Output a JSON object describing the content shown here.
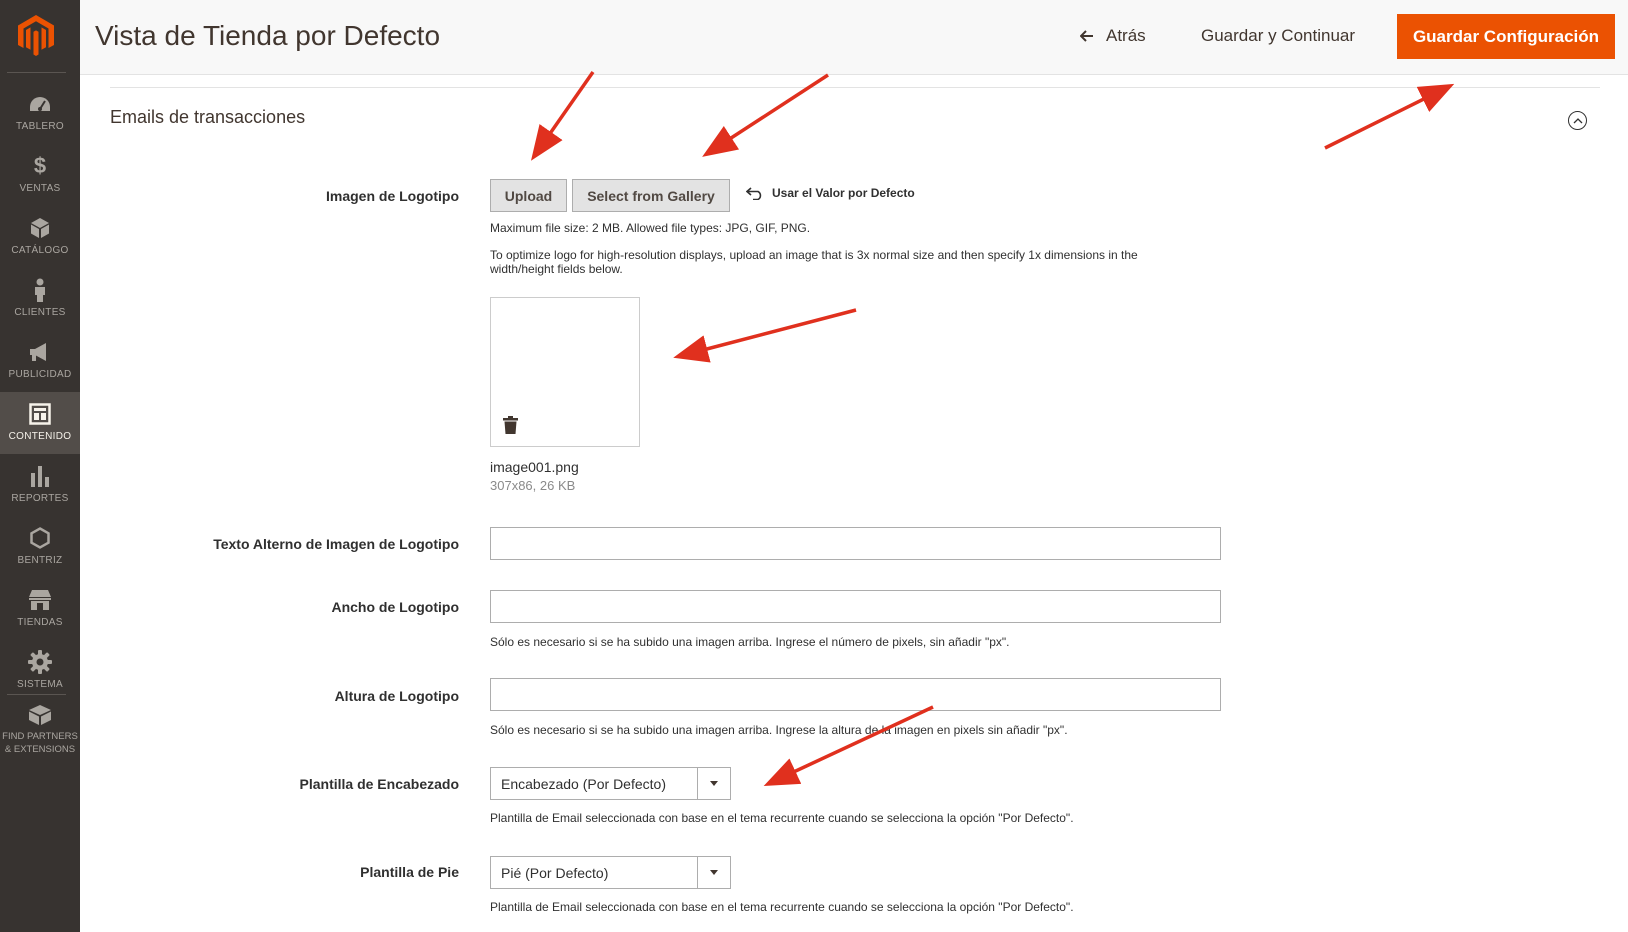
{
  "sidebar": {
    "items": [
      {
        "label": "TABLERO",
        "icon": "dashboard-icon"
      },
      {
        "label": "VENTAS",
        "icon": "dollar-icon"
      },
      {
        "label": "CATÁLOGO",
        "icon": "cube-icon"
      },
      {
        "label": "CLIENTES",
        "icon": "person-icon"
      },
      {
        "label": "PUBLICIDAD",
        "icon": "megaphone-icon"
      },
      {
        "label": "CONTENIDO",
        "icon": "layout-icon",
        "active": true
      },
      {
        "label": "REPORTES",
        "icon": "bar-chart-icon"
      },
      {
        "label": "BENTRIZ",
        "icon": "hexagon-icon"
      },
      {
        "label": "TIENDAS",
        "icon": "store-icon"
      },
      {
        "label": "SISTEMA",
        "icon": "gear-icon"
      },
      {
        "label_line1": "FIND PARTNERS",
        "label_line2": "& EXTENSIONS",
        "icon": "box-icon"
      }
    ]
  },
  "header": {
    "title": "Vista de Tienda por Defecto",
    "back_label": "Atrás",
    "save_continue_label": "Guardar y Continuar",
    "save_config_label": "Guardar Configuración"
  },
  "section": {
    "title": "Emails de transacciones"
  },
  "logo_image": {
    "label": "Imagen de Logotipo",
    "upload_label": "Upload",
    "gallery_label": "Select from Gallery",
    "use_default_label": "Usar el Valor por Defecto",
    "max_size_note": "Maximum file size: 2 MB. Allowed file types: JPG, GIF, PNG.",
    "optimize_note_line1": "To optimize logo for high-resolution displays, upload an image that is 3x normal size and then specify 1x dimensions in the",
    "optimize_note_line2": "width/height fields below.",
    "file_name": "image001.png",
    "file_meta": "307x86, 26 KB"
  },
  "alt_text": {
    "label": "Texto Alterno de Imagen de Logotipo",
    "value": ""
  },
  "logo_width": {
    "label": "Ancho de Logotipo",
    "value": "",
    "note": "Sólo es necesario si se ha subido una imagen arriba. Ingrese el número de pixels, sin añadir \"px\"."
  },
  "logo_height": {
    "label": "Altura de Logotipo",
    "value": "",
    "note": "Sólo es necesario si se ha subido una imagen arriba. Ingrese la altura de la imagen en pixels sin añadir \"px\"."
  },
  "header_template": {
    "label": "Plantilla de Encabezado",
    "selected": "Encabezado (Por Defecto)",
    "note": "Plantilla de Email seleccionada con base en el tema recurrente cuando se selecciona la opción \"Por Defecto\"."
  },
  "footer_template": {
    "label": "Plantilla de Pie",
    "selected": "Pié (Por Defecto)",
    "note": "Plantilla de Email seleccionada con base en el tema recurrente cuando se selecciona la opción \"Por Defecto\"."
  },
  "colors": {
    "accent": "#eb5202",
    "sidebar_bg": "#373330",
    "sidebar_active": "#524d49",
    "annotation_arrow": "#e0301e"
  }
}
